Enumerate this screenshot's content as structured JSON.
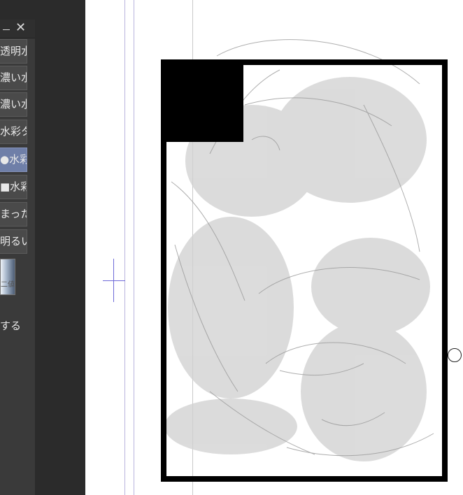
{
  "panel": {
    "items": [
      {
        "label": "透明水"
      },
      {
        "label": "濃い水"
      },
      {
        "label": "濃い水"
      },
      {
        "label": "水彩タ"
      },
      {
        "label": "●水彩",
        "selected": true
      },
      {
        "label": "■水彩"
      },
      {
        "label": "まったり"
      },
      {
        "label": "明るい"
      }
    ],
    "thumb_label": "二値",
    "footer_text": "する",
    "close_icon": "close-icon",
    "minimize_icon": "minimize-icon"
  },
  "colors": {
    "panel_bg": "#3a3a3a",
    "selected": "#6f7fa8",
    "guide": "#b9b4dd",
    "frame": "#000000"
  }
}
